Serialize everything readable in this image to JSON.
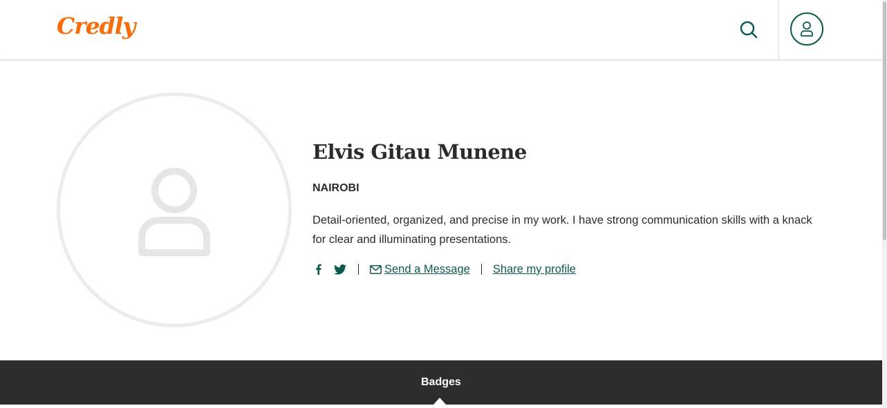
{
  "header": {
    "logo_text": "Credly",
    "brand_color": "#ff6b00",
    "accent_color": "#0b5b4c",
    "search_icon": "search-icon",
    "account_icon": "user-icon"
  },
  "profile": {
    "name": "Elvis Gitau Munene",
    "location": "NAIROBI",
    "bio": "Detail-oriented, organized, and precise in my work. I have strong communication skills with a knack for clear and illuminating presentations.",
    "avatar_icon": "user-placeholder-icon",
    "social": {
      "facebook_icon": "facebook-icon",
      "twitter_icon": "twitter-icon"
    },
    "send_message_label": "Send a Message",
    "share_profile_label": "Share my profile"
  },
  "tabs": {
    "active": "Badges",
    "items": [
      "Badges"
    ]
  }
}
